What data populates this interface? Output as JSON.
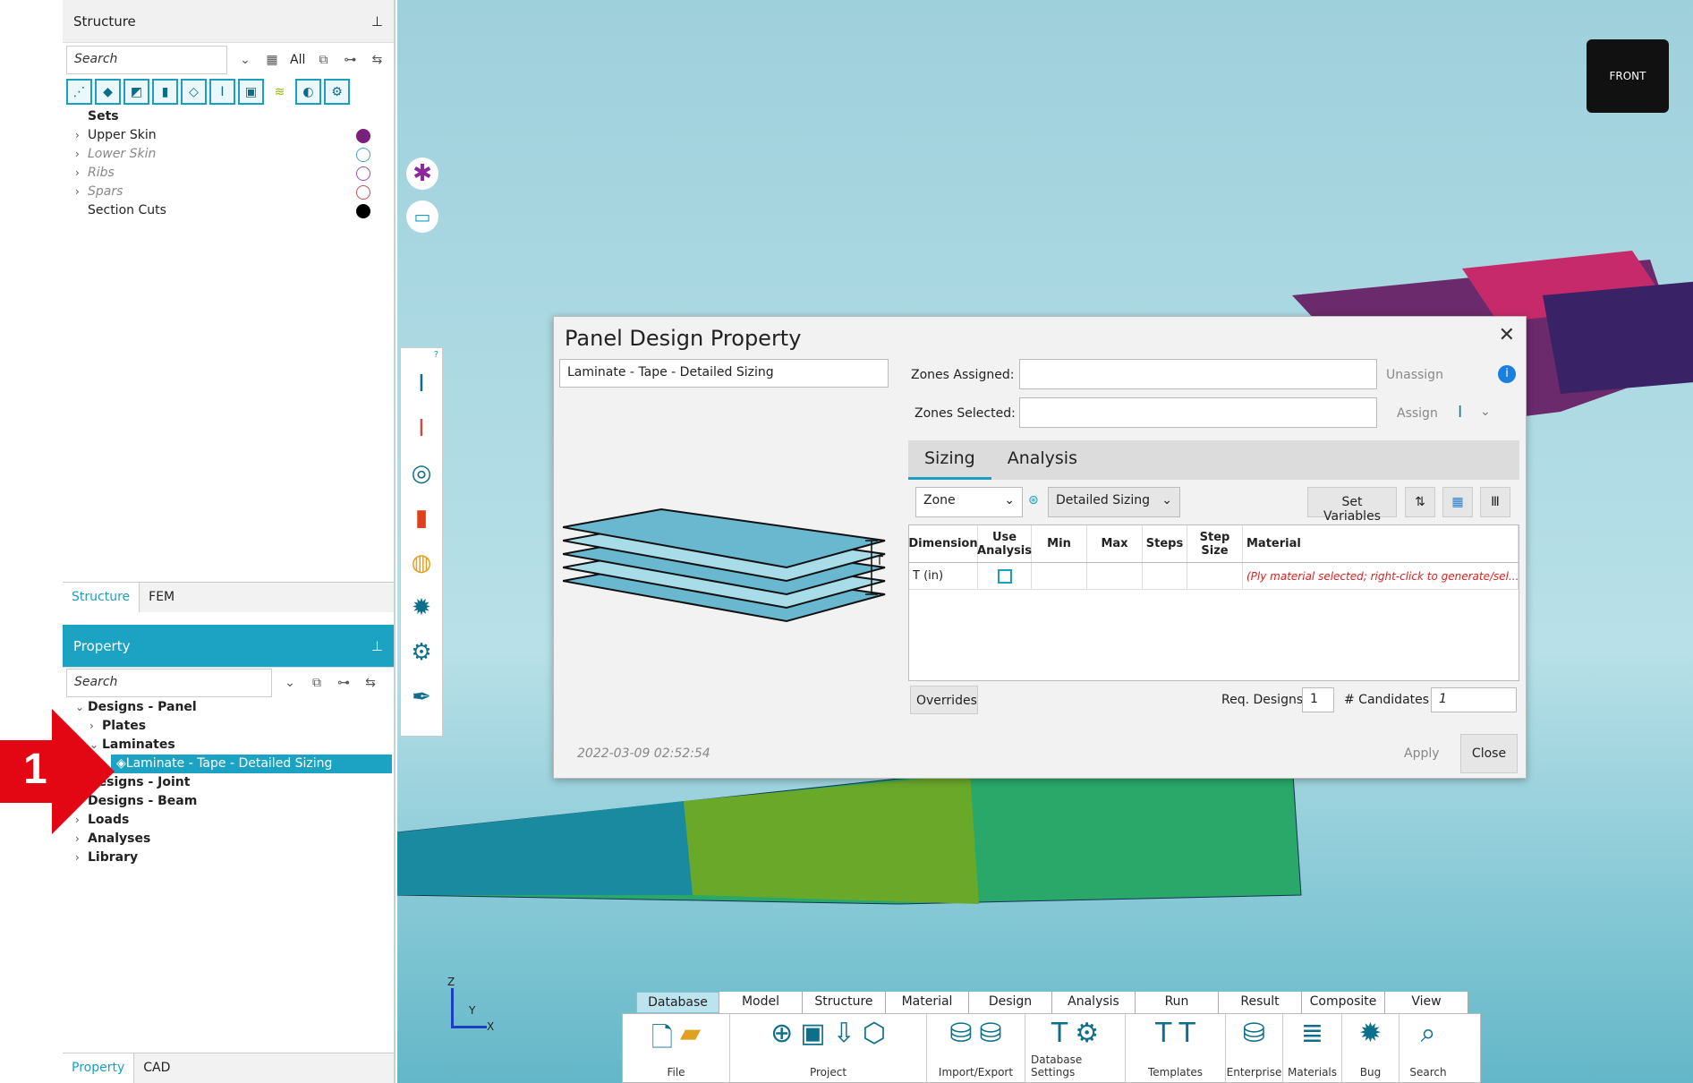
{
  "structure_panel": {
    "title": "Structure",
    "search_placeholder": "Search",
    "all_label": "All",
    "tree": [
      {
        "label": "Sets",
        "bold": true,
        "indent": 0,
        "chevron": ""
      },
      {
        "label": "Upper Skin",
        "indent": 0,
        "chevron": ">",
        "dot": "#7a1f7a",
        "filled": true
      },
      {
        "label": "Lower Skin",
        "indent": 0,
        "chevron": ">",
        "italic": true,
        "dot": "#4aa3b7"
      },
      {
        "label": "Ribs",
        "indent": 0,
        "chevron": ">",
        "italic": true,
        "dot": "#9b4fbf"
      },
      {
        "label": "Spars",
        "indent": 0,
        "chevron": ">",
        "italic": true,
        "dot": "#c0504d"
      },
      {
        "label": "Section Cuts",
        "indent": 0,
        "chevron": "",
        "dot": "#000",
        "filled": true
      }
    ],
    "tabs": {
      "structure": "Structure",
      "fem": "FEM"
    }
  },
  "property_panel": {
    "title": "Property",
    "search_placeholder": "Search",
    "tree": [
      {
        "label": "Designs - Panel",
        "chevron": "v",
        "indent": 0
      },
      {
        "label": "Plates",
        "chevron": ">",
        "indent": 1
      },
      {
        "label": "Laminates",
        "chevron": "v",
        "indent": 1
      },
      {
        "label": "Laminate - Tape - Detailed Sizing",
        "chevron": ">",
        "indent": 2,
        "selected": true
      },
      {
        "label": "Designs - Joint",
        "chevron": "",
        "indent": 0
      },
      {
        "label": "Designs - Beam",
        "chevron": "",
        "indent": 0
      },
      {
        "label": "Loads",
        "chevron": ">",
        "indent": 0
      },
      {
        "label": "Analyses",
        "chevron": ">",
        "indent": 0
      },
      {
        "label": "Library",
        "chevron": ">",
        "indent": 0
      }
    ],
    "tabs": {
      "property": "Property",
      "cad": "CAD"
    }
  },
  "callout": {
    "number": "1"
  },
  "dialog": {
    "title": "Panel Design Property",
    "name_value": "Laminate - Tape - Detailed Sizing",
    "zones_assigned_label": "Zones Assigned:",
    "zones_selected_label": "Zones Selected:",
    "unassign": "Unassign",
    "assign": "Assign",
    "tabs": {
      "sizing": "Sizing",
      "analysis": "Analysis"
    },
    "zone_select": "Zone",
    "sizing_select": "Detailed Sizing",
    "set_variables": "Set Variables",
    "columns": [
      "Dimension",
      "Use Analysis",
      "Min",
      "Max",
      "Steps",
      "Step Size",
      "Material"
    ],
    "row": {
      "dimension": "T (in)",
      "material": "(Ply material selected; right-click to generate/sel..."
    },
    "overrides": "Overrides",
    "req_designs_label": "Req. Designs",
    "req_designs": "1",
    "candidates_label": "# Candidates",
    "candidates": "1",
    "timestamp": "2022-03-09 02:52:54",
    "apply": "Apply",
    "close": "Close",
    "t_label": "T"
  },
  "ribbon": {
    "tabs": [
      "Database",
      "Model",
      "Structure",
      "Material",
      "Design",
      "Analysis",
      "Run",
      "Result",
      "Composite",
      "View"
    ],
    "groups": [
      "File",
      "Project",
      "Import/Export",
      "Database Settings",
      "Templates",
      "Enterprise",
      "Materials",
      "Bug",
      "Search"
    ]
  },
  "axis": {
    "z": "Z",
    "y": "Y",
    "x": "X"
  },
  "cube": {
    "label": "FRONT"
  }
}
